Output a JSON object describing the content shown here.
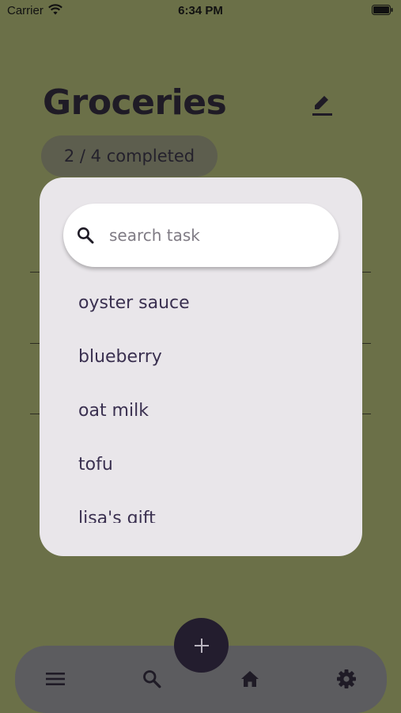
{
  "status_bar": {
    "carrier": "Carrier",
    "time": "6:34 PM"
  },
  "header": {
    "title": "Groceries",
    "progress": "2 / 4 completed"
  },
  "search_popup": {
    "placeholder": "search task",
    "results": [
      "oyster sauce",
      "blueberry",
      "oat milk",
      "tofu",
      "lisa's gift"
    ]
  },
  "bottom_nav": {
    "icons": [
      "menu-icon",
      "search-icon",
      "plus-icon",
      "home-icon",
      "settings-icon"
    ]
  },
  "colors": {
    "background": "#6b7048",
    "popup": "#e9e6ea",
    "nav": "#5c5c5f",
    "fab": "#231d2e",
    "title": "#1f1b26"
  }
}
